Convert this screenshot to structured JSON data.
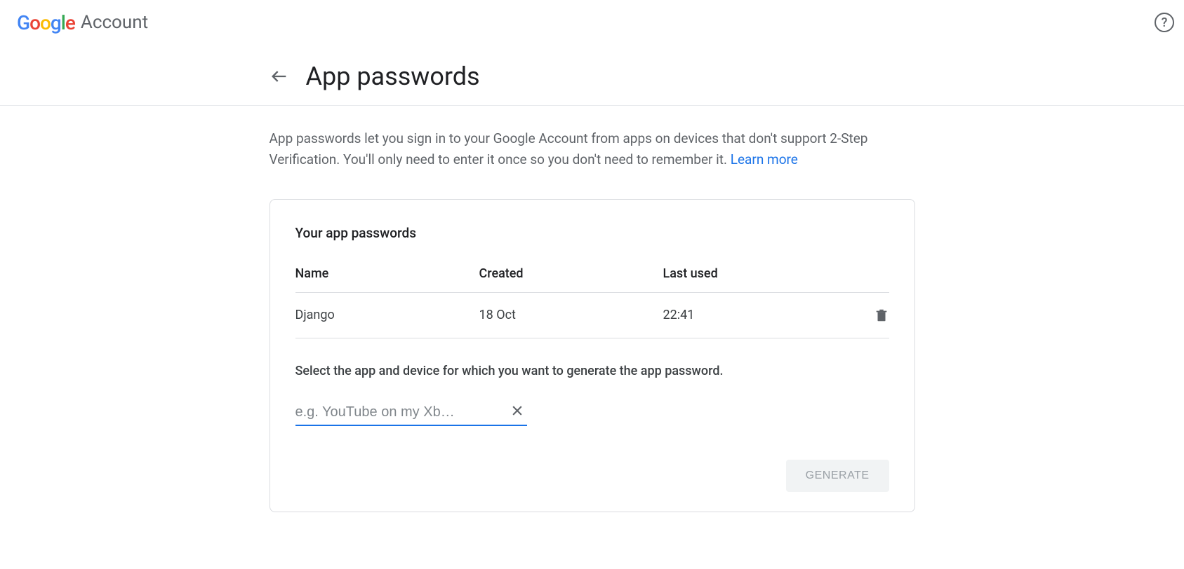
{
  "header": {
    "logo_text": "Google",
    "account_text": "Account"
  },
  "page": {
    "title": "App passwords",
    "description": "App passwords let you sign in to your Google Account from apps on devices that don't support 2-Step Verification. You'll only need to enter it once so you don't need to remember it. ",
    "learn_more": "Learn more"
  },
  "card": {
    "title": "Your app passwords",
    "columns": {
      "name": "Name",
      "created": "Created",
      "last_used": "Last used"
    },
    "rows": [
      {
        "name": "Django",
        "created": "18 Oct",
        "last_used": "22:41"
      }
    ],
    "select_text": "Select the app and device for which you want to generate the app password.",
    "input": {
      "placeholder": "e.g. YouTube on my Xb…",
      "value": ""
    },
    "generate_label": "GENERATE"
  }
}
